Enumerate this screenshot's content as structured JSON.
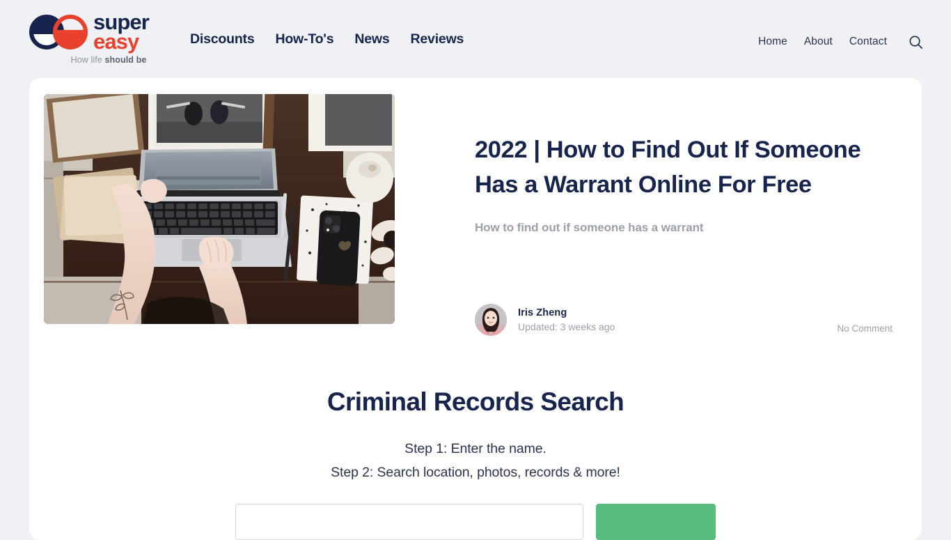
{
  "header": {
    "logo": {
      "mark_icon": "overlapping-circles-ee-logo",
      "word_top": "super",
      "word_bottom": "easy",
      "tagline_prefix": "How life ",
      "tagline_strong": "should be",
      "navy": "#17244d",
      "red": "#e8412e"
    },
    "main_nav": [
      {
        "label": "Discounts"
      },
      {
        "label": "How-To's"
      },
      {
        "label": "News"
      },
      {
        "label": "Reviews"
      }
    ],
    "util_nav": [
      {
        "label": "Home"
      },
      {
        "label": "About"
      },
      {
        "label": "Contact"
      }
    ],
    "search_icon": "search-icon"
  },
  "article": {
    "hero_image_alt": "Overhead flat-lay of a person typing on a laptop at a wooden desk with books, a phone and a notebook",
    "title": "2022 | How to Find Out If Someone Has a Warrant Online For Free",
    "subtitle": "How to find out if someone has a warrant",
    "author": {
      "name": "Iris Zheng",
      "updated": "Updated: 3 weeks ago",
      "avatar_alt": "Portrait photo of Iris Zheng"
    },
    "comments": "No Comment"
  },
  "records_widget": {
    "title": "Criminal Records Search",
    "steps": [
      "Step 1: Enter the name.",
      "Step 2: Search location, photos, records & more!"
    ],
    "input_value": "",
    "input_placeholder": "",
    "submit_label": "",
    "submit_color": "#56bd7e"
  }
}
